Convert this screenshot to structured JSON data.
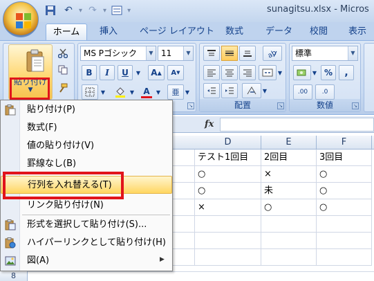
{
  "window": {
    "title": "sunagitsu.xlsx - Micros"
  },
  "qat": {
    "save_icon": "save-icon",
    "undo_icon": "undo-icon",
    "redo_icon": "redo-icon",
    "form_icon": "form-icon"
  },
  "tabs": [
    "ホーム",
    "挿入",
    "ページ レイアウト",
    "数式",
    "データ",
    "校閲",
    "表示"
  ],
  "ribbon": {
    "paste_label": "貼り付け",
    "font_name": "MS Pゴシック",
    "font_size": "11",
    "bold": "B",
    "italic": "I",
    "underline": "U",
    "grow_font": "A",
    "shrink_font": "A",
    "font_color_letter": "A",
    "phonetic": "亜",
    "number_format": "標準",
    "percent": "%",
    "comma": ",",
    "dec_inc": ".00",
    "dec_dec": ".0",
    "group_alignment": "配置",
    "group_number": "数値",
    "accent_red": "#e1141b"
  },
  "formula_bar": {
    "fx": "fx"
  },
  "grid": {
    "columns": [
      "D",
      "E",
      "F"
    ],
    "rows": [
      [
        "テスト1回目",
        "2回目",
        "3回目"
      ],
      [
        "○",
        "×",
        "○"
      ],
      [
        "○",
        "未",
        "○"
      ],
      [
        "×",
        "○",
        "○"
      ]
    ],
    "bottom_row_number": "8"
  },
  "paste_menu": {
    "items": [
      {
        "label": "貼り付け(P)",
        "icon": "paste-icon"
      },
      {
        "label": "数式(F)",
        "icon": ""
      },
      {
        "label": "値の貼り付け(V)",
        "icon": ""
      },
      {
        "label": "罫線なし(B)",
        "icon": ""
      },
      {
        "label": "行列を入れ替える(T)",
        "icon": ""
      },
      {
        "label": "リンク貼り付け(N)",
        "icon": ""
      },
      {
        "label": "形式を選択して貼り付け(S)...",
        "icon": "paste-special-icon"
      },
      {
        "label": "ハイパーリンクとして貼り付け(H)",
        "icon": "paste-hyperlink-icon"
      },
      {
        "label": "図(A)",
        "icon": "picture-icon"
      }
    ],
    "highlighted_index": 4
  }
}
